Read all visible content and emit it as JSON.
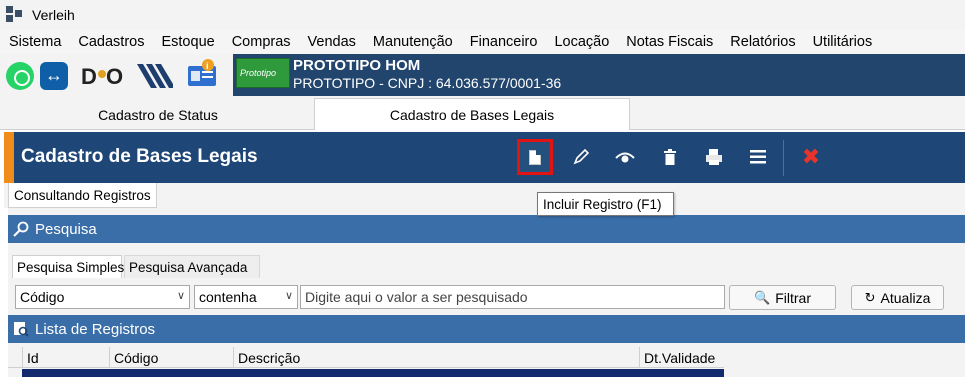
{
  "window": {
    "title": "Verleih"
  },
  "menu": [
    "Sistema",
    "Cadastros",
    "Estoque",
    "Compras",
    "Vendas",
    "Manutenção",
    "Financeiro",
    "Locação",
    "Notas Fiscais",
    "Relatórios",
    "Utilitários"
  ],
  "toolbar_icons": [
    "whatsapp-icon",
    "teamviewer-icon",
    "dq-logo-icon",
    "stripes-logo-icon",
    "id-card-icon"
  ],
  "company": {
    "logo_text": "Prototipo",
    "name": "PROTOTIPO HOM",
    "details": "PROTOTIPO - CNPJ : 64.036.577/0001-36"
  },
  "tabs": [
    "Cadastro de Status",
    "Cadastro de Bases Legais"
  ],
  "header": {
    "title": "Cadastro de Bases Legais"
  },
  "actions": [
    "new-record-icon",
    "edit-icon",
    "view-icon",
    "delete-icon",
    "print-icon",
    "list-icon",
    "close-icon"
  ],
  "tooltip": "Incluir Registro (F1)",
  "subtab": "Consultando Registros",
  "search": {
    "section_title": "Pesquisa",
    "tab_simple": "Pesquisa Simples",
    "tab_advanced": "Pesquisa Avançada",
    "field": "Código",
    "operator": "contenha",
    "placeholder": "Digite aqui o valor a ser pesquisado",
    "filter_button": "Filtrar",
    "refresh_button": "Atualiza"
  },
  "records": {
    "section_title": "Lista de Registros",
    "columns": [
      "Id",
      "Código",
      "Descrição",
      "Dt.Validade"
    ]
  },
  "colors": {
    "header_bg": "#1e4676",
    "accent": "#f08c1a",
    "section_bg": "#3a6ea8",
    "selected_row": "#132a6e",
    "highlight_border": "#e11414"
  }
}
